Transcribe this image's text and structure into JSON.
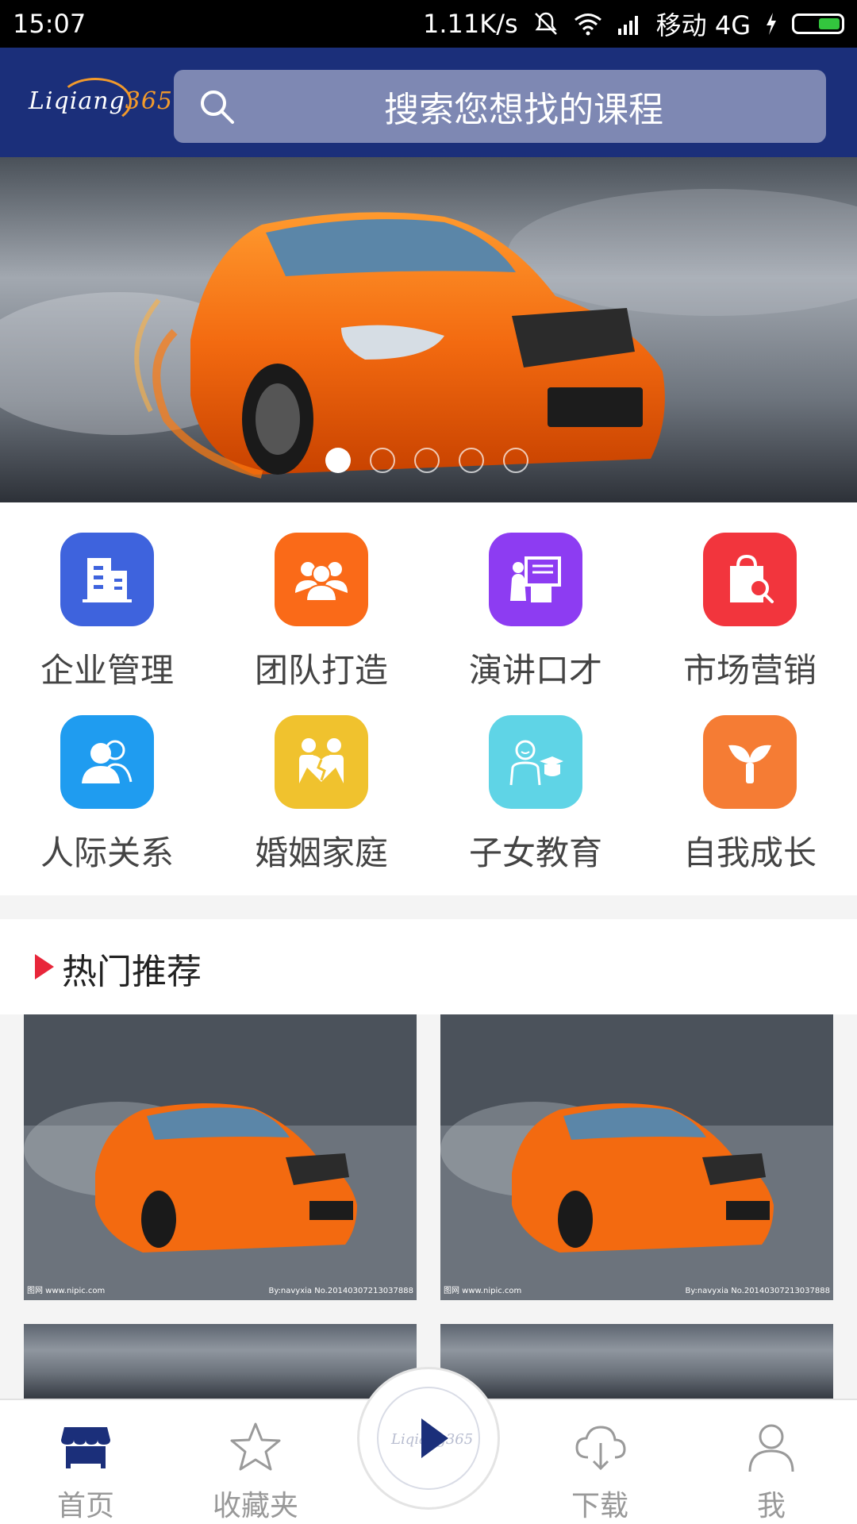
{
  "status_bar": {
    "time": "15:07",
    "speed": "1.11K/s",
    "carrier": "移动 4G"
  },
  "header": {
    "logo_text": "Liqiang",
    "logo_num": "365",
    "search_placeholder": "搜索您想找的课程"
  },
  "banner": {
    "slide_count": 5,
    "active_slide": 1
  },
  "categories": [
    {
      "label": "企业管理",
      "icon": "building-icon",
      "color": "#3e63dd"
    },
    {
      "label": "团队打造",
      "icon": "team-icon",
      "color": "#fa6a18"
    },
    {
      "label": "演讲口才",
      "icon": "speech-icon",
      "color": "#8d3cf2"
    },
    {
      "label": "市场营销",
      "icon": "shopping-bag-icon",
      "color": "#f2353d"
    },
    {
      "label": "人际关系",
      "icon": "people-icon",
      "color": "#1f9cf0"
    },
    {
      "label": "婚姻家庭",
      "icon": "broken-heart-icon",
      "color": "#f0c22e"
    },
    {
      "label": "子女教育",
      "icon": "graduate-icon",
      "color": "#5fd4e6"
    },
    {
      "label": "自我成长",
      "icon": "sprout-icon",
      "color": "#f57c34"
    }
  ],
  "hot": {
    "title": "热门推荐"
  },
  "thumb_watermark_left": "图网 www.nipic.com",
  "thumb_watermark_right": "By:navyxia No.20140307213037888",
  "tabbar": {
    "home": "首页",
    "favorites": "收藏夹",
    "downloads": "下载",
    "me": "我"
  },
  "colors": {
    "header_bg": "#1b2f7a",
    "search_bg": "#7e88b3",
    "accent_red": "#e8263a",
    "home_icon": "#1b2f7a"
  }
}
